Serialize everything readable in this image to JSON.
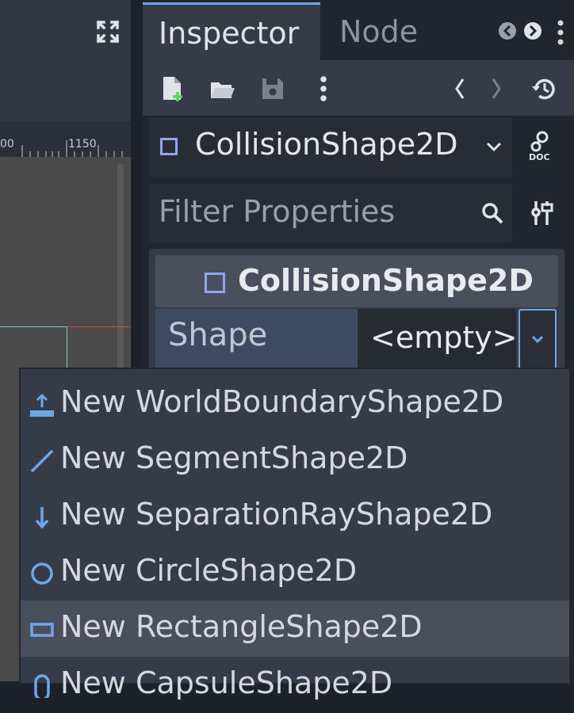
{
  "viewport": {
    "ruler_labels": [
      "00",
      "1150"
    ]
  },
  "dock": {
    "tabs": [
      {
        "label": "Inspector",
        "active": true
      },
      {
        "label": "Node",
        "active": false
      }
    ]
  },
  "inspector": {
    "node_name": "CollisionShape2D",
    "filter_placeholder": "Filter Properties",
    "section_title": "CollisionShape2D",
    "property": {
      "label": "Shape",
      "value": "<empty>"
    }
  },
  "shape_menu": {
    "items": [
      {
        "label": "New WorldBoundaryShape2D",
        "icon": "world-boundary-icon"
      },
      {
        "label": "New SegmentShape2D",
        "icon": "segment-icon"
      },
      {
        "label": "New SeparationRayShape2D",
        "icon": "separation-ray-icon"
      },
      {
        "label": "New CircleShape2D",
        "icon": "circle-icon"
      },
      {
        "label": "New RectangleShape2D",
        "icon": "rectangle-icon",
        "highlighted": true
      },
      {
        "label": "New CapsuleShape2D",
        "icon": "capsule-icon"
      }
    ]
  },
  "colors": {
    "accent": "#6ea7e6",
    "node_icon": "#8da5f3",
    "panel": "#363c47",
    "background": "#21252d"
  }
}
